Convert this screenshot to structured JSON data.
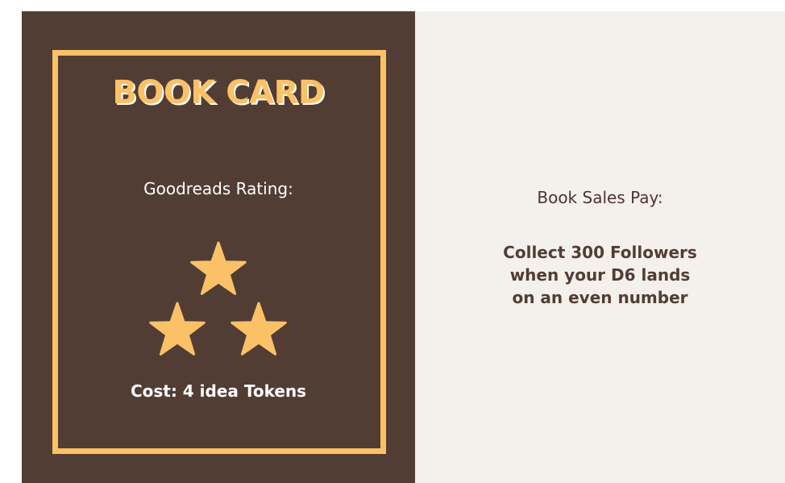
{
  "card_front": {
    "title": "BOOK CARD",
    "rating_label": "Goodreads Rating:",
    "rating_stars": 3,
    "cost": "Cost: 4 idea Tokens"
  },
  "card_back": {
    "pay_label": "Book Sales Pay:",
    "pay_lines": [
      "Collect 300 Followers",
      "when your D6 lands",
      "on an even number"
    ]
  },
  "colors": {
    "card_brown": "#523d34",
    "accent_gold": "#fbc167",
    "back_cream": "#f4f0ec",
    "text_white": "#ffffff"
  },
  "icons": {
    "rating": "star-icon"
  }
}
